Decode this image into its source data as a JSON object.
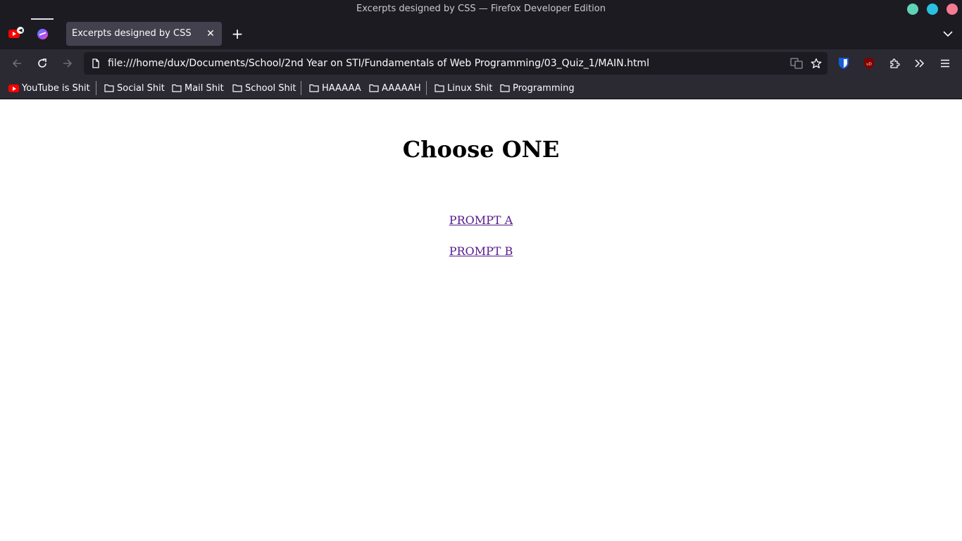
{
  "window": {
    "title": "Excerpts designed by CSS — Firefox Developer Edition",
    "controls": [
      {
        "name": "minimize",
        "color": "#5fd3b5"
      },
      {
        "name": "maximize",
        "color": "#29c1e0"
      },
      {
        "name": "close",
        "color": "#f57a93"
      }
    ]
  },
  "tabs": {
    "pinned": [
      {
        "icon": "youtube-icon",
        "playing_audio": true
      },
      {
        "icon": "messenger-icon"
      }
    ],
    "active": {
      "label": "Excerpts designed by CSS",
      "close_symbol": "✕"
    },
    "new_tab_symbol": "+"
  },
  "navbar": {
    "url": "file:///home/dux/Documents/School/2nd Year on STI/Fundamentals of Web Programming/03_Quiz_1/MAIN.html",
    "buttons": [
      "back-icon",
      "reload-icon",
      "forward-icon"
    ],
    "url_actions": [
      "translate-icon",
      "bookmark-star-icon"
    ],
    "toolbar": [
      "bitwarden-icon",
      "ublock-origin-icon",
      "extensions-icon",
      "overflow-chevron-icon",
      "menu-icon"
    ]
  },
  "bookmarks": [
    {
      "label": "YouTube is Shit",
      "icon": "youtube-icon"
    },
    {
      "label": "Social Shit",
      "icon": "folder-icon"
    },
    {
      "label": "Mail Shit",
      "icon": "folder-icon"
    },
    {
      "label": "School Shit",
      "icon": "folder-icon"
    },
    {
      "label": "HAAAAA",
      "icon": "folder-icon"
    },
    {
      "label": "AAAAAH",
      "icon": "folder-icon"
    },
    {
      "label": "Linux Shit",
      "icon": "folder-icon"
    },
    {
      "label": "Programming",
      "icon": "folder-icon"
    }
  ],
  "page": {
    "heading": "Choose ONE",
    "links": [
      "PROMPT A",
      "PROMPT B"
    ],
    "link_color": "#551a8b"
  }
}
